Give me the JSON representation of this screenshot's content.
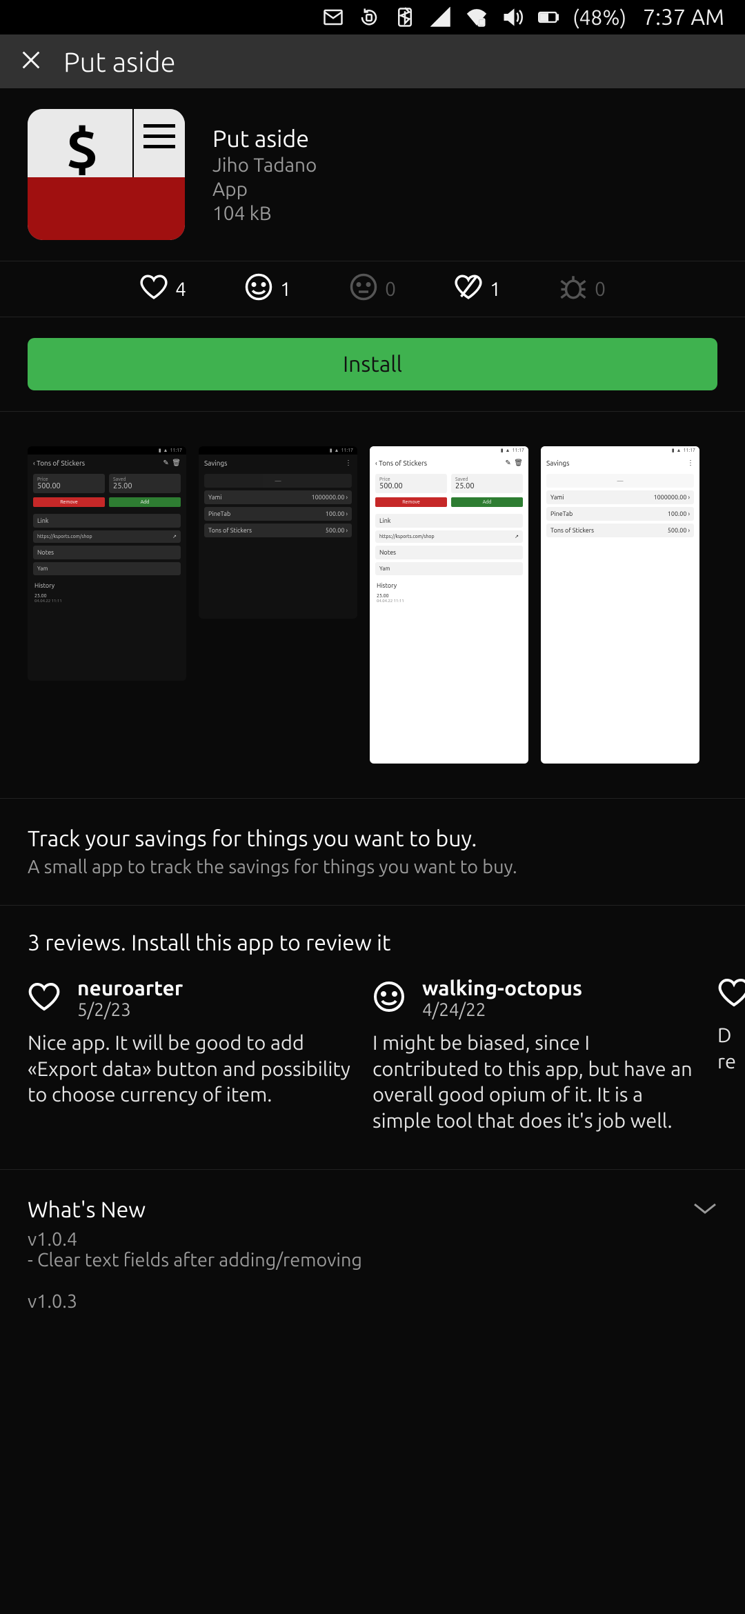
{
  "status": {
    "battery_pct": "(48%)",
    "time": "7:37 AM"
  },
  "header": {
    "title": "Put aside"
  },
  "app": {
    "name": "Put aside",
    "developer": "Jiho Tadano",
    "category": "App",
    "size": "104 kB"
  },
  "reactions": {
    "like": "4",
    "happy": "1",
    "neutral": "0",
    "broken": "1",
    "bug": "0"
  },
  "install_label": "Install",
  "shots": {
    "A": {
      "title": "Tons of Stickers",
      "price_lbl": "Price",
      "price_val": "500.00",
      "saved_lbl": "Saved",
      "saved_val": "25.00",
      "btn_remove": "Remove",
      "btn_add": "Add",
      "link_lbl": "Link",
      "link_val": "https://ksports.com/shop",
      "notes_lbl": "Notes",
      "notes_val": "Yam",
      "hist": "History",
      "h1": "25.00",
      "h2": "04.04.22 11:11"
    },
    "B": {
      "title": "Savings",
      "r1n": "Yami",
      "r1v": "1000000.00",
      "r2n": "PineTab",
      "r2v": "100.00",
      "r3n": "Tons of Stickers",
      "r3v": "500.00"
    }
  },
  "desc": {
    "headline": "Track your savings for things you want to buy.",
    "sub": "A small app to track the savings for things you want to buy."
  },
  "reviews_header": "3 reviews. Install this app to review it",
  "reviews": [
    {
      "name": "neuroarter",
      "date": "5/2/23",
      "body": "Nice app. It will be good to add «Export data» button and possibility to choose currency of item."
    },
    {
      "name": "walking-octopus",
      "date": "4/24/22",
      "body": "I might be biased, since I contributed to this app, but have an overall good opium of it. It is a simple tool that does it's job well."
    },
    {
      "name": "D",
      "date": "",
      "body": "re"
    }
  ],
  "whatsnew": {
    "title": "What's New",
    "v1": "v1.0.4",
    "n1": "- Clear text fields after adding/removing",
    "v2": "v1.0.3"
  }
}
